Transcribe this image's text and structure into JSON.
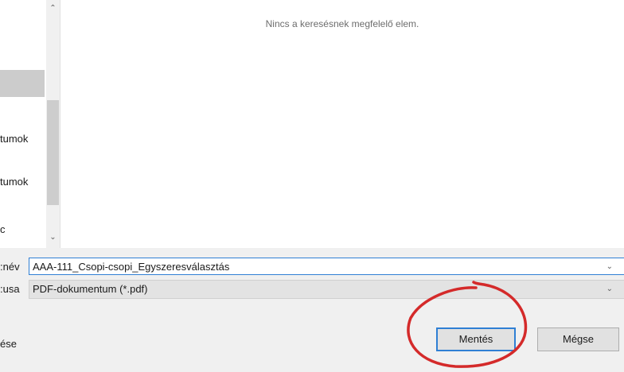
{
  "nav_pane": {
    "items": [
      {
        "label": ""
      },
      {
        "label": "tumok"
      },
      {
        "label": "tumok"
      },
      {
        "label": "c"
      }
    ]
  },
  "content": {
    "empty_message": "Nincs a keresésnek megfelelő elem."
  },
  "save_form": {
    "filename_label": "név:",
    "filename_value": "AAA-111_Csopi-csopi_Egyszeresválasztás",
    "filetype_label": "usa:",
    "filetype_value": "PDF-dokumentum (*.pdf)",
    "hide_folders_label": "ése",
    "save_button": "Mentés",
    "cancel_button": "Mégse"
  },
  "annotation": {
    "color": "#d42a2a"
  }
}
